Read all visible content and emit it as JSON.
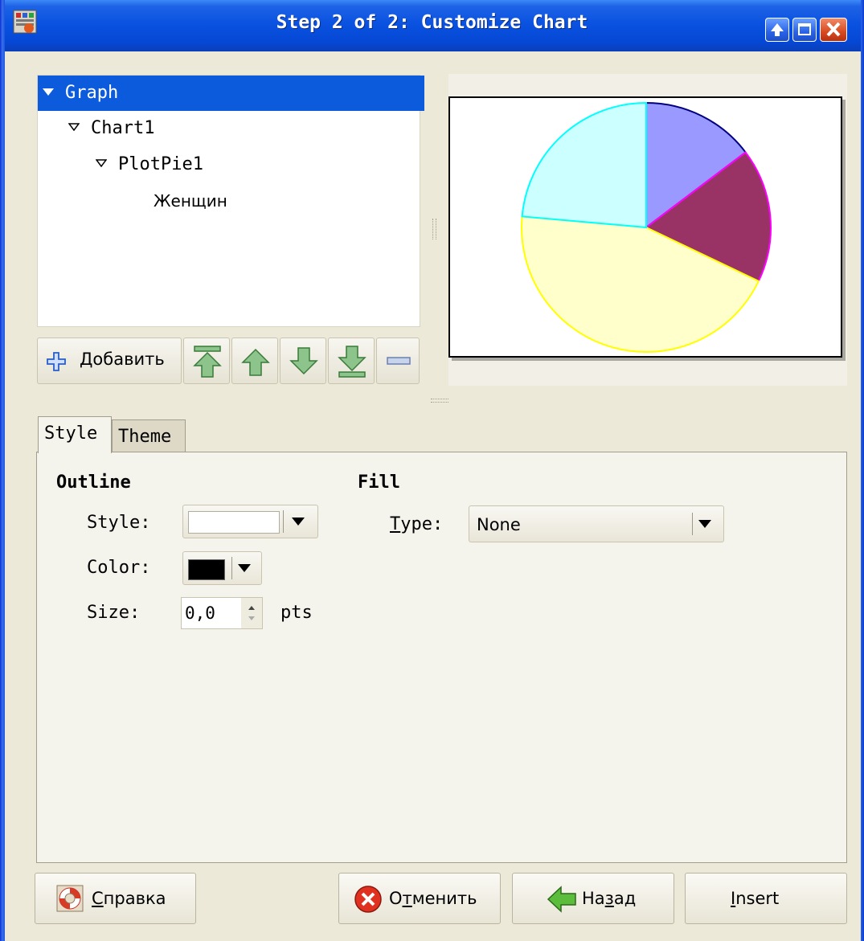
{
  "window": {
    "title": "Step 2 of 2: Customize Chart"
  },
  "tree": {
    "items": [
      {
        "label": "Graph",
        "selected": true
      },
      {
        "label": "Chart1"
      },
      {
        "label": "PlotPie1"
      },
      {
        "label": "Женщин"
      }
    ]
  },
  "toolbar": {
    "add": {
      "accel": "Д",
      "rest": "обавить"
    }
  },
  "preview": {
    "chart_data": {
      "type": "pie",
      "values": [
        14.7,
        17.4,
        44.3,
        23.6
      ],
      "colors": [
        "#9999ff",
        "#993366",
        "#ffffcc",
        "#ccffff"
      ],
      "outline_colors": [
        "#000080",
        "#ff00ff",
        "#ffff00",
        "#00ffff"
      ]
    }
  },
  "tabs": [
    {
      "label": "Style",
      "active": true
    },
    {
      "label": "Theme",
      "active": false
    }
  ],
  "style_tab": {
    "outline_heading": "Outline",
    "fill_heading": "Fill",
    "style_label": "Style:",
    "color_label": "Color:",
    "color_value": "#000000",
    "size_label": "Size:",
    "size_value": "0,0",
    "size_unit": "pts",
    "type_label_accel": "T",
    "type_label_rest": "ype:",
    "type_value": "None"
  },
  "buttons": {
    "help": {
      "accel": "С",
      "rest": "правка"
    },
    "cancel": {
      "pre": "О",
      "accel": "т",
      "rest": "менить"
    },
    "back": {
      "pre": "На",
      "accel": "з",
      "rest": "ад"
    },
    "insert": {
      "accel": "I",
      "rest": "nsert"
    }
  }
}
